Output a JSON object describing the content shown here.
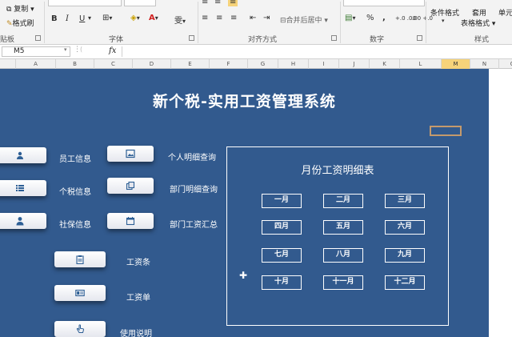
{
  "ribbon": {
    "clipboard": {
      "copy": "复制",
      "format_painter": "格式刷",
      "group": "贴板"
    },
    "font": {
      "group": "字体",
      "bold": "B",
      "italic": "I",
      "underline": "U",
      "font_color_glyph": "A",
      "phonetic_glyph": "雯"
    },
    "alignment": {
      "group": "对齐方式",
      "merge": "合并后居中"
    },
    "number": {
      "group": "数字",
      "percent": "%",
      "comma": ",",
      "increase_decimal": "+.0 .00",
      "decrease_decimal": ".00 +.0"
    },
    "styles": {
      "group": "样式",
      "conditional": "条件格式",
      "apply_table": "套用",
      "table_format": "表格格式",
      "cell_styles": "单元"
    }
  },
  "formula_bar": {
    "name_box": "M5",
    "fx": "fx",
    "formula": ""
  },
  "columns": [
    "A",
    "B",
    "C",
    "D",
    "E",
    "F",
    "G",
    "H",
    "I",
    "J",
    "K",
    "L",
    "M",
    "N",
    "O"
  ],
  "selected_column": "M",
  "sheet": {
    "title": "新个税-实用工资管理系统",
    "buttons": {
      "employee": "员工信息",
      "tax": "个税信息",
      "social": "社保信息",
      "personal_detail": "个人明细查询",
      "dept_detail": "部门明细查询",
      "dept_summary": "部门工资汇总",
      "payslip_strip": "工资条",
      "payslip": "工资单",
      "manual": "使用说明"
    },
    "panel": {
      "title": "月份工资明细表",
      "months": [
        "一月",
        "二月",
        "三月",
        "四月",
        "五月",
        "六月",
        "七月",
        "八月",
        "九月",
        "十月",
        "十一月",
        "十二月"
      ]
    }
  },
  "colors": {
    "sheet_bg": "#325a8e",
    "selected_header": "#f6d37a",
    "marker": "#c49a6c"
  }
}
